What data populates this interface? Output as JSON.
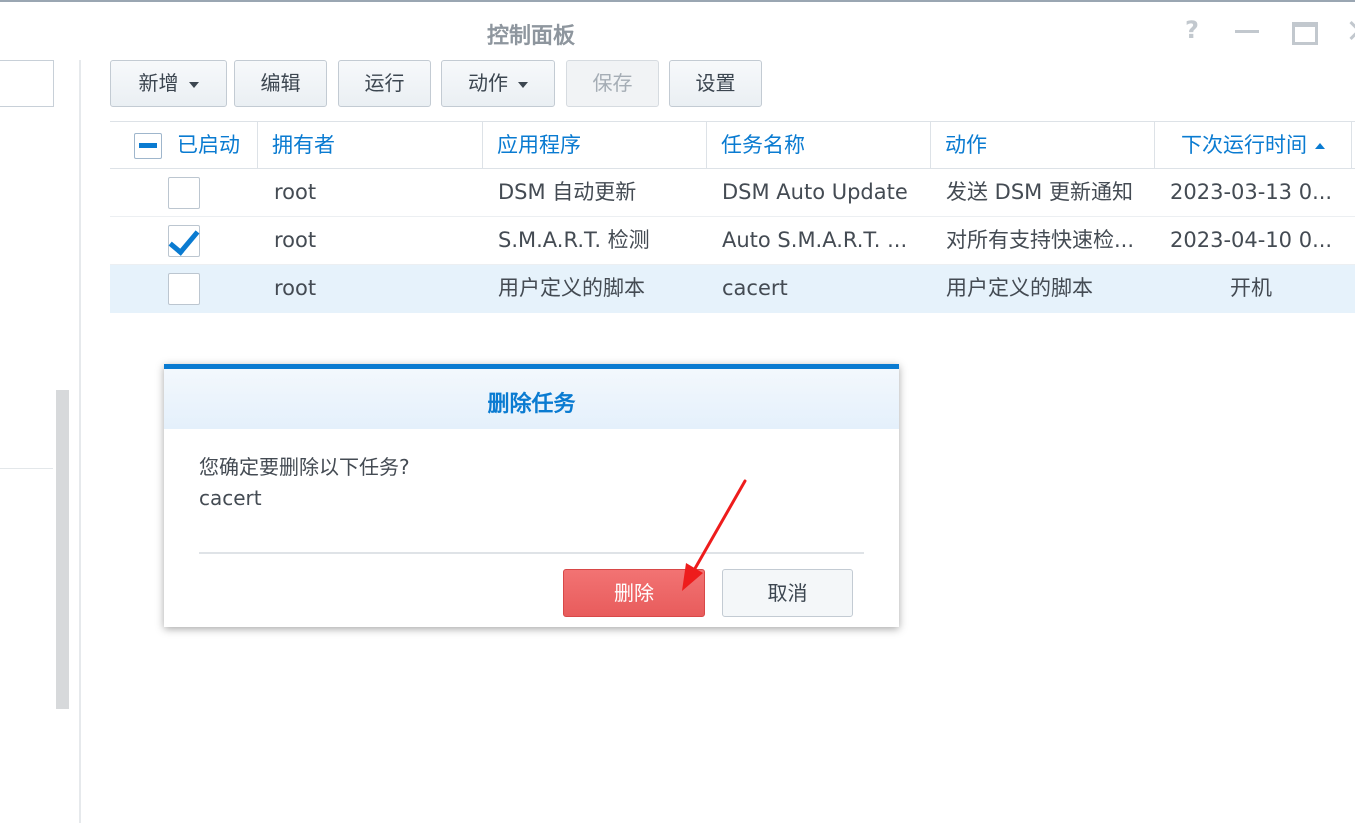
{
  "window": {
    "title": "控制面板",
    "help_glyph": "?"
  },
  "toolbar": {
    "add_label": "新增",
    "edit_label": "编辑",
    "run_label": "运行",
    "action_label": "动作",
    "save_label": "保存",
    "settings_label": "设置"
  },
  "table": {
    "columns": [
      "已启动",
      "拥有者",
      "应用程序",
      "任务名称",
      "动作",
      "下次运行时间"
    ],
    "rows": [
      {
        "enabled": false,
        "owner": "root",
        "app": "DSM 自动更新",
        "task": "DSM Auto Update",
        "action": "发送 DSM 更新通知",
        "next_run": "2023-03-13 0..."
      },
      {
        "enabled": true,
        "owner": "root",
        "app": "S.M.A.R.T. 检测",
        "task": "Auto S.M.A.R.T. ...",
        "action": "对所有支持快速检...",
        "next_run": "2023-04-10 0..."
      },
      {
        "enabled": false,
        "owner": "root",
        "app": "用户定义的脚本",
        "task": "cacert",
        "action": "用户定义的脚本",
        "next_run": "开机"
      }
    ]
  },
  "dialog": {
    "title": "删除任务",
    "question": "您确定要删除以下任务?",
    "task_name": "cacert",
    "delete_label": "删除",
    "cancel_label": "取消"
  },
  "colors": {
    "accent": "#0a7bd1",
    "danger": "#e85c5c",
    "annotation": "#ee1c1c",
    "selected_row": "#e6f2fb"
  }
}
